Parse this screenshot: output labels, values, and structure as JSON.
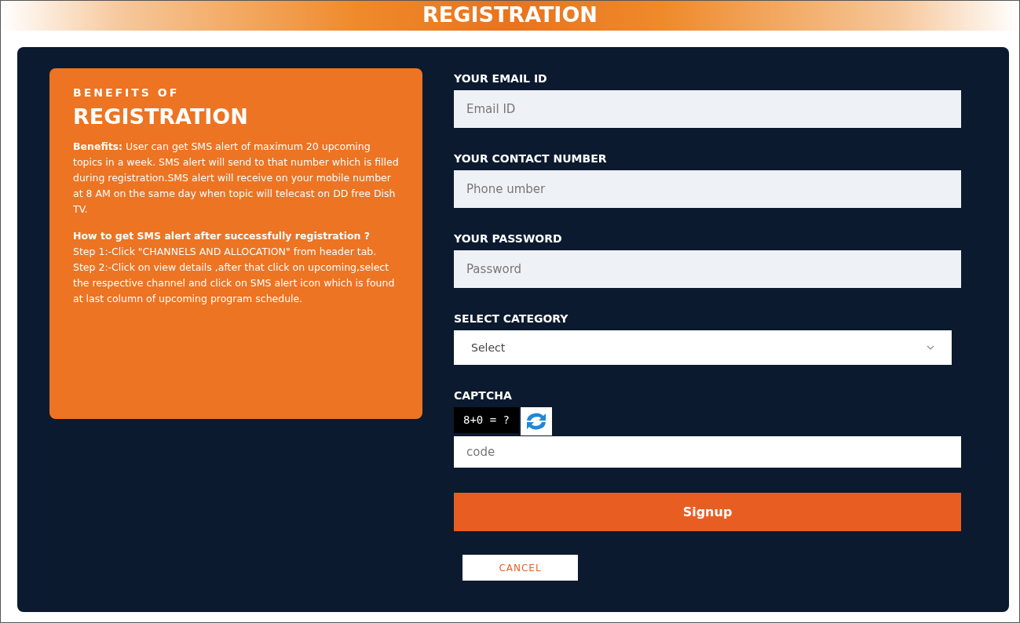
{
  "page_title": "REGISTRATION",
  "benefits": {
    "subtitle": "BENEFITS OF",
    "title": "REGISTRATION",
    "paragraph": "**Benefits:** User can get SMS alert of maximum 20 upcoming topics in a week. SMS alert will send to that number which is filled during registration.SMS alert will receive on your mobile number at 8 AM on the same day when topic will telecast on DD free Dish TV.",
    "how_to_heading": "How to get SMS alert after successfully registration ?",
    "steps": [
      "Step 1:-Click \"CHANNELS AND ALLOCATION\" from header tab.",
      "Step 2:-Click on view details ,after that click on upcoming,select the respective channel and click on SMS alert icon which is found at last column of upcoming program schedule."
    ]
  },
  "form": {
    "fields": [
      {
        "kind": "input",
        "label": "YOUR EMAIL ID",
        "placeholder": "Email ID"
      },
      {
        "kind": "input",
        "label": "YOUR CONTACT NUMBER",
        "placeholder": "Phone umber"
      },
      {
        "kind": "input",
        "label": "YOUR PASSWORD",
        "placeholder": "Password"
      },
      {
        "kind": "select",
        "label": "SELECT CATEGORY",
        "value": "Select"
      },
      {
        "kind": "captcha",
        "label": "CAPTCHA",
        "question": "8+0 = ?",
        "placeholder": "code"
      }
    ],
    "submit": "Signup",
    "cancel": "CANCEL"
  }
}
